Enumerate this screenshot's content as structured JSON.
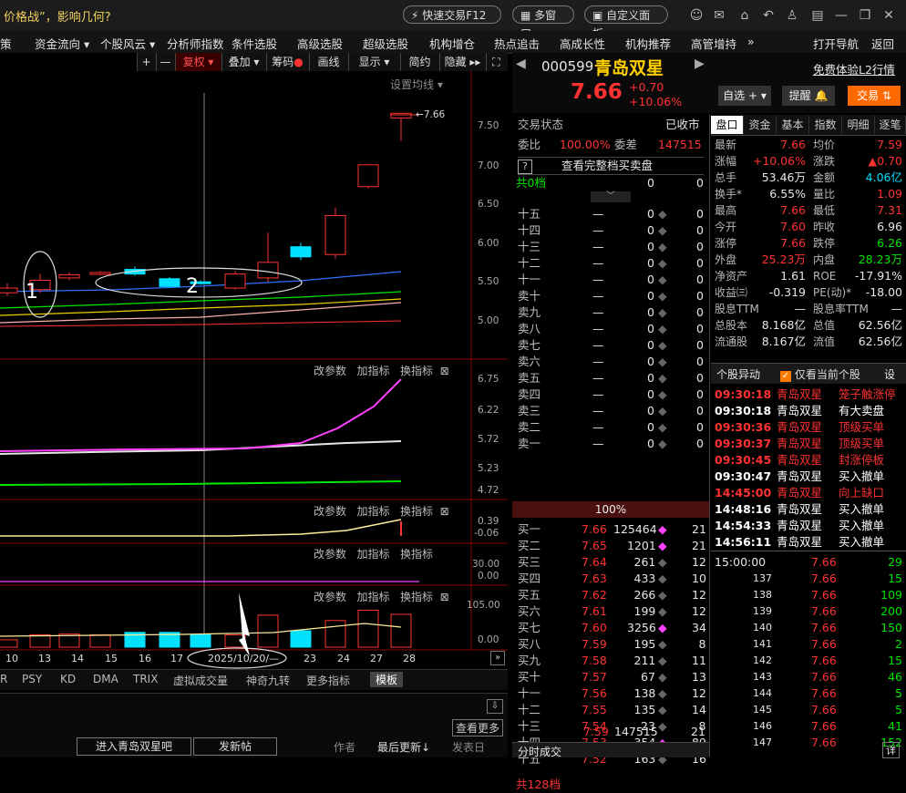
{
  "headline": "价格战”，影响几何?",
  "top_buttons": {
    "quick_trade": "快速交易F12",
    "multi_window": "多窗口",
    "custom_panel": "自定义面板"
  },
  "menu": [
    "策",
    "资金流向 ▾",
    "个股风云 ▾",
    "分析师指数",
    "条件选股",
    "高级选股",
    "超级选股",
    "机构增仓",
    "热点追击",
    "高成长性",
    "机构推荐",
    "高管增持",
    "»",
    "打开导航",
    "返回"
  ],
  "chart_toolbar": {
    "plus": "+",
    "minus": "—",
    "restore": "复权 ▾",
    "overlay": "叠加 ▾",
    "chips": "筹码",
    "draw": "画线",
    "display": "显示 ▾",
    "simple": "简约",
    "hide": "隐藏 ▸▸"
  },
  "ma_setting": "设置均线 ▾",
  "price_tag": "7.66",
  "price_axis": [
    "7.50",
    "7.00",
    "6.50",
    "6.00",
    "5.50",
    "5.00"
  ],
  "annotations": {
    "one": "1",
    "two": "2"
  },
  "sub_panels": [
    {
      "h1": "改参数",
      "h2": "加指标",
      "h3": "换指标",
      "axis": [
        "6.75",
        "6.22",
        "5.72",
        "5.23",
        "4.72"
      ]
    },
    {
      "h1": "改参数",
      "h2": "加指标",
      "h3": "换指标",
      "axis": [
        "0.39",
        "-0.06"
      ]
    },
    {
      "h1": "改参数",
      "h2": "加指标",
      "h3": "换指标",
      "axis": [
        "30.00",
        "0.00"
      ]
    },
    {
      "h1": "改参数",
      "h2": "加指标",
      "h3": "换指标",
      "axis": [
        "105.00",
        "0.00"
      ]
    }
  ],
  "dates": [
    "10",
    "13",
    "14",
    "15",
    "16",
    "17",
    "2025/10/20/—",
    "23",
    "24",
    "27",
    "28"
  ],
  "indicator_tabs": [
    "R",
    "PSY",
    "KD",
    "DMA",
    "TRIX",
    "虚拟成交量",
    "神奇九转",
    "更多指标",
    "模板"
  ],
  "bottom": {
    "view_more": "查看更多",
    "forum": "进入青岛双星吧",
    "post": "发新帖",
    "author": "作者",
    "last_update": "最后更新↓",
    "post_date": "发表日"
  },
  "stock": {
    "code": "000599",
    "name": "青岛双星",
    "price": "7.66",
    "change": "+0.70",
    "change_pct": "+10.06%",
    "l2": "免费体验L2行情",
    "watch": "自选 + ▾",
    "alert": "提醒",
    "trade": "交易 ⇅"
  },
  "trade_status": {
    "label": "交易状态",
    "value": "已收市",
    "wb_label": "委比",
    "wb": "100.00%",
    "wc_label": "委差",
    "wc": "147515",
    "full_book": "查看完整档买卖盘",
    "total_sell": "共0档",
    "pct": "100%",
    "total_buy": "共128档",
    "total_buy_price": "7.59",
    "total_buy_vol": "147515",
    "total_buy_cnt": "21"
  },
  "sell_levels": [
    "十五",
    "十四",
    "十三",
    "十二",
    "十一",
    "卖十",
    "卖九",
    "卖八",
    "卖七",
    "卖六",
    "卖五",
    "卖四",
    "卖三",
    "卖二",
    "卖一"
  ],
  "buy_levels": [
    {
      "l": "买一",
      "p": "7.66",
      "v": "125464",
      "c": "21",
      "dot": "m"
    },
    {
      "l": "买二",
      "p": "7.65",
      "v": "1201",
      "c": "21",
      "dot": "m"
    },
    {
      "l": "买三",
      "p": "7.64",
      "v": "261",
      "c": "12",
      "dot": ""
    },
    {
      "l": "买四",
      "p": "7.63",
      "v": "433",
      "c": "10",
      "dot": ""
    },
    {
      "l": "买五",
      "p": "7.62",
      "v": "266",
      "c": "12",
      "dot": ""
    },
    {
      "l": "买六",
      "p": "7.61",
      "v": "199",
      "c": "12",
      "dot": ""
    },
    {
      "l": "买七",
      "p": "7.60",
      "v": "3256",
      "c": "34",
      "dot": "m"
    },
    {
      "l": "买八",
      "p": "7.59",
      "v": "195",
      "c": "8",
      "dot": ""
    },
    {
      "l": "买九",
      "p": "7.58",
      "v": "211",
      "c": "11",
      "dot": ""
    },
    {
      "l": "买十",
      "p": "7.57",
      "v": "67",
      "c": "13",
      "dot": ""
    },
    {
      "l": "十一",
      "p": "7.56",
      "v": "138",
      "c": "12",
      "dot": ""
    },
    {
      "l": "十二",
      "p": "7.55",
      "v": "135",
      "c": "14",
      "dot": ""
    },
    {
      "l": "十三",
      "p": "7.54",
      "v": "23",
      "c": "8",
      "dot": ""
    },
    {
      "l": "十四",
      "p": "7.53",
      "v": "354",
      "c": "89",
      "dot": "m"
    },
    {
      "l": "十五",
      "p": "7.52",
      "v": "163",
      "c": "16",
      "dot": ""
    }
  ],
  "tabs": [
    "盘口",
    "资金",
    "基本",
    "指数",
    "明细",
    "逐笔"
  ],
  "quote": [
    {
      "a": "最新",
      "av": "7.66",
      "ac": "red",
      "b": "均价",
      "bv": "7.59",
      "bc": "red"
    },
    {
      "a": "涨幅",
      "av": "+10.06%",
      "ac": "red",
      "b": "涨跌",
      "bv": "▲0.70",
      "bc": "red"
    },
    {
      "a": "总手",
      "av": "53.46万",
      "ac": "white",
      "b": "金额",
      "bv": "4.06亿",
      "bc": "cyan"
    },
    {
      "a": "换手*",
      "av": "6.55%",
      "ac": "white",
      "b": "量比",
      "bv": "1.09",
      "bc": "red"
    },
    {
      "a": "最高",
      "av": "7.66",
      "ac": "red",
      "b": "最低",
      "bv": "7.31",
      "bc": "red"
    },
    {
      "a": "今开",
      "av": "7.60",
      "ac": "red",
      "b": "昨收",
      "bv": "6.96",
      "bc": "white"
    },
    {
      "a": "涨停",
      "av": "7.66",
      "ac": "red",
      "b": "跌停",
      "bv": "6.26",
      "bc": "green"
    },
    {
      "a": "外盘",
      "av": "25.23万",
      "ac": "red",
      "b": "内盘",
      "bv": "28.23万",
      "bc": "green"
    },
    {
      "a": "净资产",
      "av": "1.61",
      "ac": "white",
      "b": "ROE",
      "bv": "-17.91%",
      "bc": "white"
    },
    {
      "a": "收益㈢",
      "av": "-0.319",
      "ac": "white",
      "b": "PE(动)*",
      "bv": "-18.00",
      "bc": "white"
    },
    {
      "a": "股息TTM",
      "av": "—",
      "ac": "white",
      "b": "股息率TTM",
      "bv": "—",
      "bc": "white"
    },
    {
      "a": "总股本",
      "av": "8.168亿",
      "ac": "white",
      "b": "总值",
      "bv": "62.56亿",
      "bc": "white"
    },
    {
      "a": "流通股",
      "av": "8.167亿",
      "ac": "white",
      "b": "流值",
      "bv": "62.56亿",
      "bc": "white"
    }
  ],
  "anomaly": {
    "title": "个股异动",
    "only_current": "仅看当前个股",
    "settings": "设"
  },
  "anomaly_rows": [
    {
      "t": "09:30:18",
      "n": "青岛双星",
      "e": "笼子触涨停",
      "c": "red"
    },
    {
      "t": "09:30:18",
      "n": "青岛双星",
      "e": "有大卖盘",
      "c": "white"
    },
    {
      "t": "09:30:36",
      "n": "青岛双星",
      "e": "顶级买单",
      "c": "red"
    },
    {
      "t": "09:30:37",
      "n": "青岛双星",
      "e": "顶级买单",
      "c": "red"
    },
    {
      "t": "09:30:45",
      "n": "青岛双星",
      "e": "封涨停板",
      "c": "red"
    },
    {
      "t": "09:30:47",
      "n": "青岛双星",
      "e": "买入撤单",
      "c": "white"
    },
    {
      "t": "14:45:00",
      "n": "青岛双星",
      "e": "向上缺口",
      "c": "red"
    },
    {
      "t": "14:48:16",
      "n": "青岛双星",
      "e": "买入撤单",
      "c": "white"
    },
    {
      "t": "14:54:33",
      "n": "青岛双星",
      "e": "买入撤单",
      "c": "white"
    },
    {
      "t": "14:56:11",
      "n": "青岛双星",
      "e": "买入撤单",
      "c": "white"
    }
  ],
  "ticks": [
    {
      "t": "15:00:00",
      "p": "7.66",
      "v": "29"
    },
    {
      "t": "137",
      "p": "7.66",
      "v": "15"
    },
    {
      "t": "138",
      "p": "7.66",
      "v": "109"
    },
    {
      "t": "139",
      "p": "7.66",
      "v": "200"
    },
    {
      "t": "140",
      "p": "7.66",
      "v": "150"
    },
    {
      "t": "141",
      "p": "7.66",
      "v": "2"
    },
    {
      "t": "142",
      "p": "7.66",
      "v": "15"
    },
    {
      "t": "143",
      "p": "7.66",
      "v": "46"
    },
    {
      "t": "144",
      "p": "7.66",
      "v": "5"
    },
    {
      "t": "145",
      "p": "7.66",
      "v": "5"
    },
    {
      "t": "146",
      "p": "7.66",
      "v": "41"
    },
    {
      "t": "147",
      "p": "7.66",
      "v": "152"
    }
  ],
  "minute_footer": "分时成交",
  "detail_btn": "详",
  "colors": {
    "up": "#ff3232",
    "down": "#00e0ff",
    "ma5": "#ffffff",
    "ma10": "#e8d000",
    "ma20": "#ff40ff",
    "ma60": "#00e600",
    "ma120": "#3070ff"
  }
}
